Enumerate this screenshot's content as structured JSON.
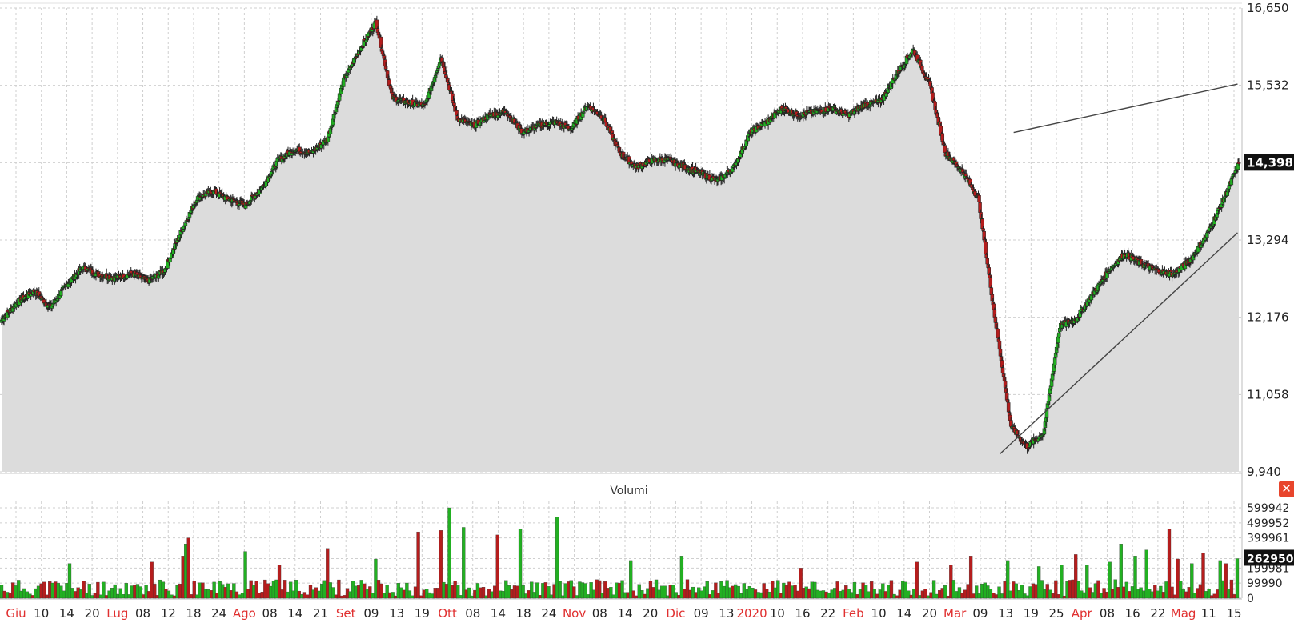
{
  "volume_panel": {
    "title": "Volumi"
  },
  "colors": {
    "up": "#22b022",
    "down": "#b51d1d",
    "area": "#dcdcdc",
    "grid": "#cfcfcf",
    "month_label": "#e03030",
    "trend": "#444444"
  },
  "icons": {
    "close": "close-icon"
  },
  "chart_data": [
    {
      "type": "candlestick",
      "title": "",
      "xlabel": "",
      "ylabel": "",
      "grid": true,
      "ylim": [
        9940,
        16650
      ],
      "y_ticks": [
        "16,650",
        "15,532",
        "14,398",
        "13,294",
        "12,176",
        "11,058",
        "9,940"
      ],
      "last_value_label": "14,398",
      "x_ticks": [
        {
          "label": "Giu",
          "month": true
        },
        {
          "label": "10"
        },
        {
          "label": "14"
        },
        {
          "label": "20"
        },
        {
          "label": "Lug",
          "month": true
        },
        {
          "label": "08"
        },
        {
          "label": "12"
        },
        {
          "label": "18"
        },
        {
          "label": "24"
        },
        {
          "label": "Ago",
          "month": true
        },
        {
          "label": "08"
        },
        {
          "label": "14"
        },
        {
          "label": "21"
        },
        {
          "label": "Set",
          "month": true
        },
        {
          "label": "09"
        },
        {
          "label": "13"
        },
        {
          "label": "19"
        },
        {
          "label": "Ott",
          "month": true
        },
        {
          "label": "08"
        },
        {
          "label": "14"
        },
        {
          "label": "18"
        },
        {
          "label": "24"
        },
        {
          "label": "Nov",
          "month": true
        },
        {
          "label": "08"
        },
        {
          "label": "14"
        },
        {
          "label": "20"
        },
        {
          "label": "Dic",
          "month": true
        },
        {
          "label": "09"
        },
        {
          "label": "13"
        },
        {
          "label": "2020",
          "month": true
        },
        {
          "label": "10"
        },
        {
          "label": "16"
        },
        {
          "label": "22"
        },
        {
          "label": "Feb",
          "month": true
        },
        {
          "label": "10"
        },
        {
          "label": "14"
        },
        {
          "label": "20"
        },
        {
          "label": "Mar",
          "month": true
        },
        {
          "label": "09"
        },
        {
          "label": "13"
        },
        {
          "label": "19"
        },
        {
          "label": "25"
        },
        {
          "label": "Apr",
          "month": true
        },
        {
          "label": "08"
        },
        {
          "label": "16"
        },
        {
          "label": "22"
        },
        {
          "label": "Mag",
          "month": true
        },
        {
          "label": "11"
        },
        {
          "label": "15"
        }
      ],
      "close_anchors": [
        12140,
        12400,
        12560,
        12320,
        12650,
        12900,
        12790,
        12750,
        12810,
        12700,
        12850,
        13400,
        13900,
        14000,
        13880,
        13800,
        14050,
        14450,
        14600,
        14550,
        14750,
        15600,
        16050,
        16450,
        15350,
        15280,
        15230,
        15950,
        15050,
        14950,
        15100,
        15150,
        14850,
        14950,
        15000,
        14900,
        15250,
        15050,
        14550,
        14350,
        14450,
        14450,
        14350,
        14250,
        14150,
        14350,
        14850,
        15000,
        15200,
        15100,
        15150,
        15200,
        15100,
        15250,
        15300,
        15700,
        16050,
        15550,
        14550,
        14300,
        13900,
        12200,
        10600,
        10300,
        10500,
        12050,
        12150,
        12500,
        12850,
        13100,
        12950,
        12850,
        12800,
        13000,
        13350,
        13850,
        14398
      ],
      "anchor_step": 20,
      "trend_channel": {
        "upper": [
          [
            12400,
            14850
          ],
          [
            13100,
            15550
          ]
        ],
        "lower": [
          [
            10300,
            10200
          ],
          [
            11140,
            13400
          ]
        ]
      }
    },
    {
      "type": "bar",
      "title": "Volumi",
      "y_ticks": [
        "599942",
        "499952",
        "399961",
        "262950",
        "199981",
        "99990",
        "0"
      ],
      "last_value_label": "262950",
      "ylim": [
        0,
        599942
      ],
      "spikes": [
        [
          24,
          230000
        ],
        [
          53,
          240000
        ],
        [
          64,
          280000
        ],
        [
          65,
          360000
        ],
        [
          66,
          400000
        ],
        [
          86,
          310000
        ],
        [
          98,
          220000
        ],
        [
          115,
          330000
        ],
        [
          132,
          260000
        ],
        [
          147,
          440000
        ],
        [
          155,
          450000
        ],
        [
          158,
          599942
        ],
        [
          163,
          470000
        ],
        [
          175,
          420000
        ],
        [
          183,
          460000
        ],
        [
          196,
          540000
        ],
        [
          222,
          250000
        ],
        [
          240,
          280000
        ],
        [
          282,
          200000
        ],
        [
          323,
          240000
        ],
        [
          335,
          220000
        ],
        [
          342,
          280000
        ],
        [
          355,
          250000
        ],
        [
          366,
          210000
        ],
        [
          374,
          220000
        ],
        [
          379,
          290000
        ],
        [
          383,
          220000
        ],
        [
          391,
          240000
        ],
        [
          395,
          360000
        ],
        [
          400,
          280000
        ],
        [
          404,
          320000
        ],
        [
          412,
          460000
        ],
        [
          415,
          260000
        ],
        [
          420,
          230000
        ],
        [
          424,
          300000
        ],
        [
          430,
          250000
        ],
        [
          432,
          230000
        ],
        [
          436,
          262950
        ]
      ]
    }
  ]
}
